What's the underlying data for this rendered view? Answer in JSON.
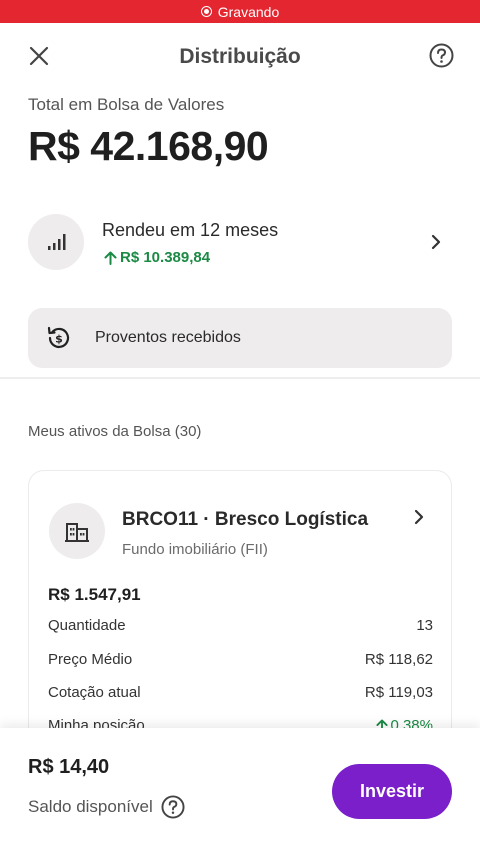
{
  "status_bar": {
    "recording_label": "Gravando"
  },
  "header": {
    "title": "Distribuição"
  },
  "summary": {
    "total_label": "Total em Bolsa de Valores",
    "total_value": "R$ 42.168,90"
  },
  "yield": {
    "title": "Rendeu em 12 meses",
    "value": "R$ 10.389,84",
    "color": "#1a8a44"
  },
  "proventos": {
    "label": "Proventos recebidos"
  },
  "assets": {
    "title": "Meus ativos da Bolsa (30)",
    "items": [
      {
        "name": "BRCO11 · Bresco Logística",
        "type": "Fundo imobiliário (FII)",
        "total": "R$ 1.547,91",
        "rows": [
          {
            "label": "Quantidade",
            "value": "13"
          },
          {
            "label": "Preço Médio",
            "value": "R$ 118,62"
          },
          {
            "label": "Cotação atual",
            "value": "R$ 119,03"
          },
          {
            "label": "Minha posição",
            "value": "0,38%"
          }
        ]
      }
    ]
  },
  "footer": {
    "balance_value": "R$ 14,40",
    "balance_label": "Saldo disponível",
    "invest_label": "Investir",
    "accent": "#7a1fc9"
  },
  "icons": [
    "close-icon",
    "help-icon",
    "signal-bars-icon",
    "chevron-right-icon",
    "dollar-history-icon",
    "building-icon",
    "arrow-up-icon"
  ]
}
